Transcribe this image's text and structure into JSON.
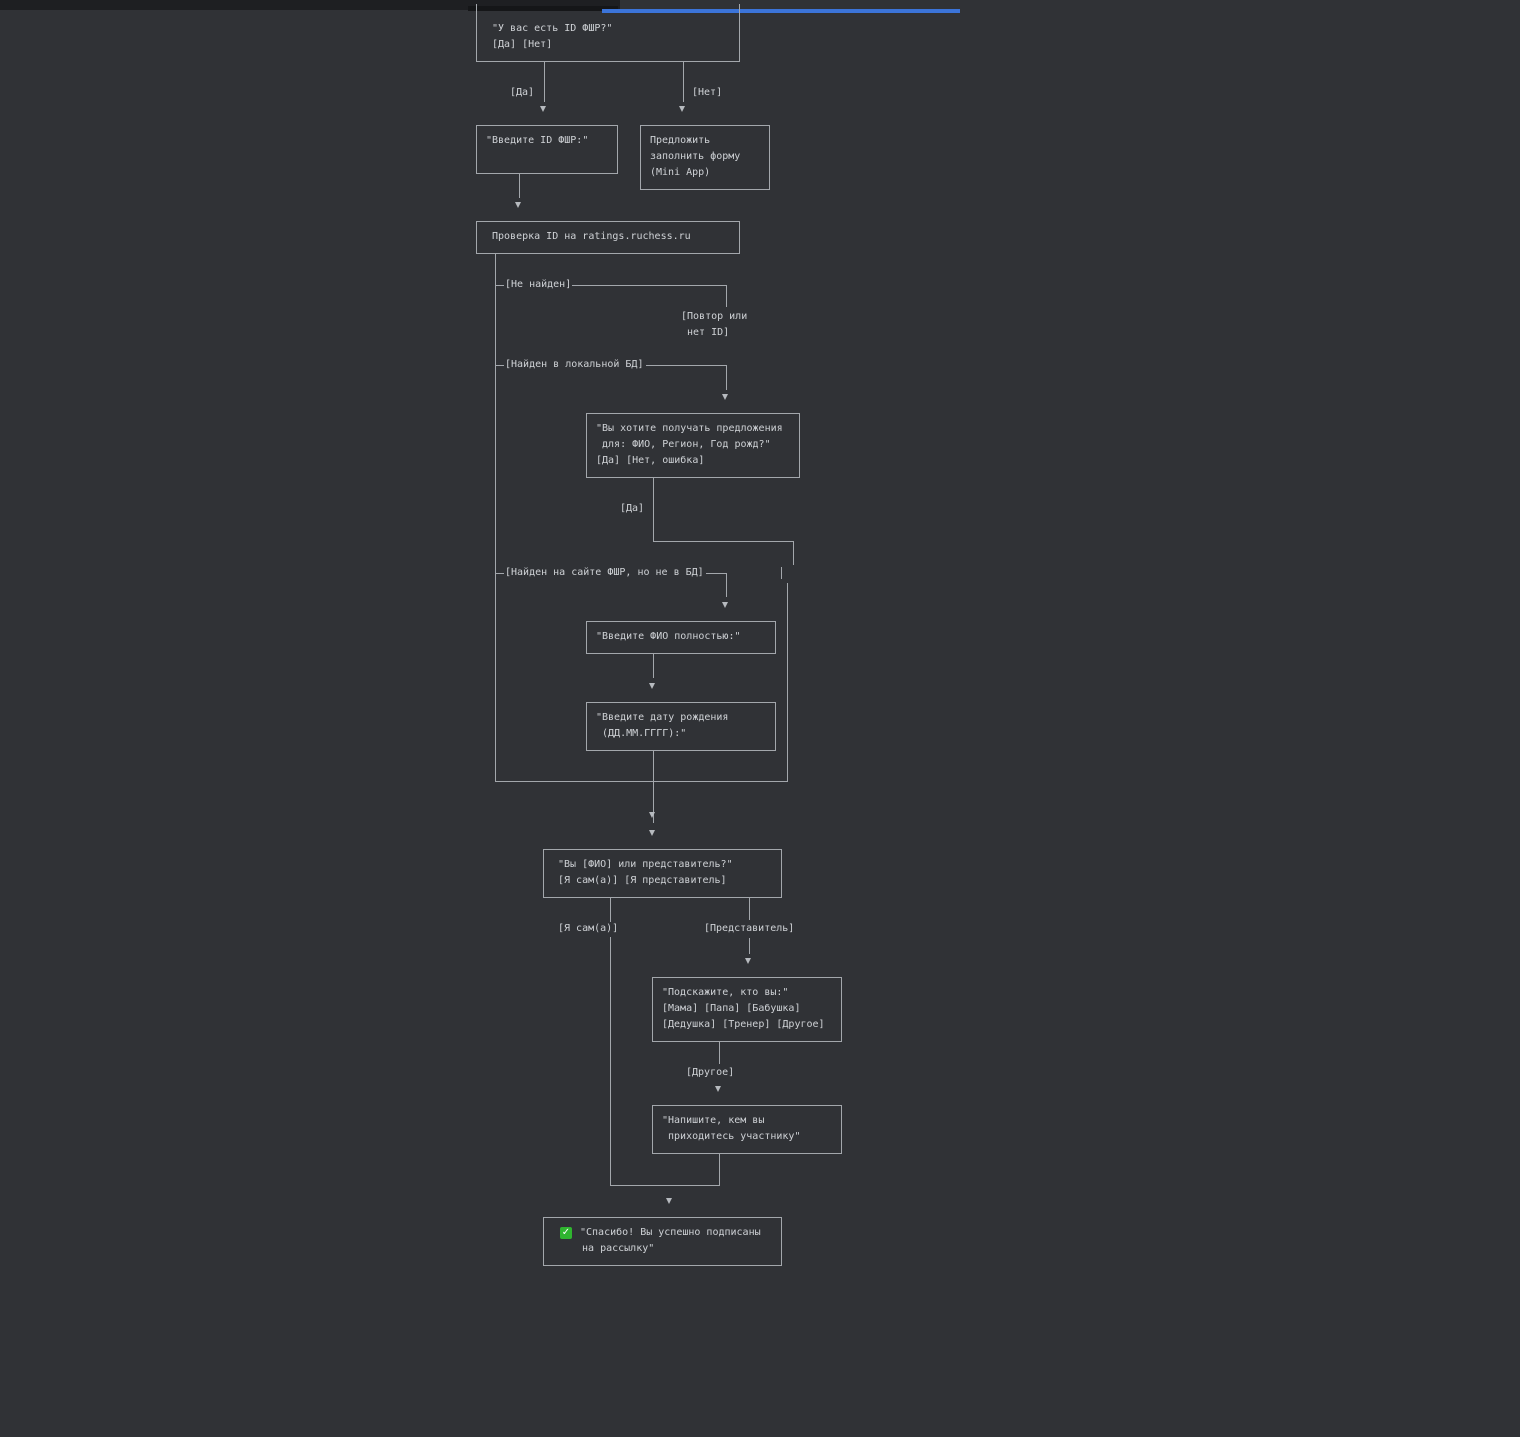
{
  "colors": {
    "background": "#303236",
    "line": "#a3a7ac",
    "text": "#cfd2d6",
    "progress": "#3b74d9",
    "check": "#2fb52f"
  },
  "nodes": {
    "has_id": [
      "\"У вас есть ID ФШР?\"",
      "[Да] [Нет]"
    ],
    "enter_id": [
      "\"Введите ID ФШР:\""
    ],
    "offer_form": [
      "Предложить",
      "заполнить форму",
      "(Mini App)"
    ],
    "check_id": [
      "Проверка ID на ratings.ruchess.ru"
    ],
    "confirm_data": [
      "\"Вы хотите получать предложения",
      " для: ФИО, Регион, Год рожд?\"",
      "[Да] [Нет, ошибка]"
    ],
    "enter_fio": [
      "\"Введите ФИО полностью:\""
    ],
    "enter_birth": [
      "\"Введите дату рождения",
      " (ДД.ММ.ГГГГ):\""
    ],
    "self_or_rep": [
      "\"Вы [ФИО] или представитель?\"",
      "[Я сам(а)] [Я представитель]"
    ],
    "who_are_you": [
      "\"Подскажите, кто вы:\"",
      "[Мама] [Папа] [Бабушка]",
      "[Дедушка] [Тренер] [Другое]"
    ],
    "write_relation": [
      "\"Напишите, кем вы",
      " приходитесь участнику\""
    ],
    "success": [
      "\"Спасибо! Вы успешно подписаны",
      " на рассылку\""
    ]
  },
  "edges": {
    "yes": "[Да]",
    "no": "[Нет]",
    "not_found": "[Не найден]",
    "retry": [
      "[Повтор или",
      " нет ID]"
    ],
    "found_local": "[Найден в локальной БД]",
    "yes2": "[Да]",
    "found_site": "[Найден на сайте ФШР, но не в БД]",
    "self": "[Я сам(а)]",
    "rep": "[Представитель]",
    "other": "[Другое]"
  },
  "icons": {
    "success": "check-mark-button-icon"
  }
}
